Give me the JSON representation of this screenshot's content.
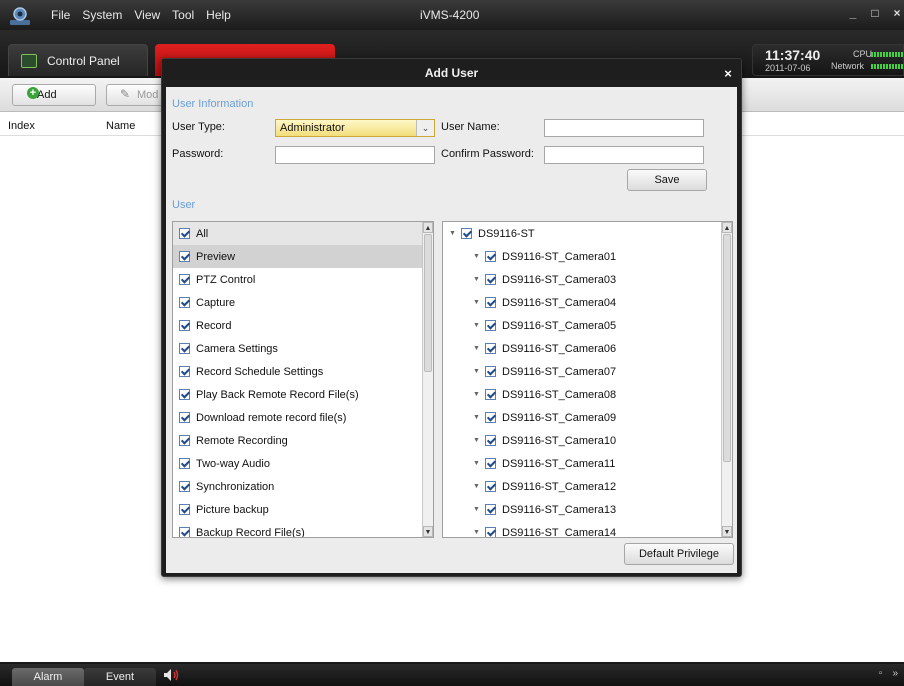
{
  "app": {
    "menu": [
      "File",
      "System",
      "View",
      "Tool",
      "Help"
    ],
    "title": "iVMS-4200",
    "window_buttons": [
      "_",
      "□",
      "×"
    ]
  },
  "tabs": {
    "control_panel": "Control Panel"
  },
  "clock": {
    "time": "11:37:40",
    "date": "2011-07-06",
    "cpu_label": "CPU",
    "network_label": "Network"
  },
  "toolbar": {
    "add_label": "Add",
    "modify_label": "Mod"
  },
  "list_columns": {
    "index": "Index",
    "name": "Name"
  },
  "status_tabs": {
    "alarm": "Alarm",
    "event": "Event"
  },
  "dialog": {
    "title": "Add User",
    "close": "×",
    "section_user_info": "User Information",
    "user_type_label": "User Type:",
    "user_type_value": "Administrator",
    "user_name_label": "User Name:",
    "user_name_value": "",
    "password_label": "Password:",
    "password_value": "",
    "confirm_password_label": "Confirm Password:",
    "confirm_password_value": "",
    "save_label": "Save",
    "section_user": "User",
    "default_privilege_label": "Default Privilege"
  },
  "permissions": {
    "all_label": "All",
    "items": [
      {
        "label": "Preview",
        "checked": true,
        "selected": true
      },
      {
        "label": "PTZ Control",
        "checked": true
      },
      {
        "label": "Capture",
        "checked": true
      },
      {
        "label": "Record",
        "checked": true
      },
      {
        "label": "Camera Settings",
        "checked": true
      },
      {
        "label": "Record Schedule Settings",
        "checked": true
      },
      {
        "label": "Play Back Remote Record File(s)",
        "checked": true
      },
      {
        "label": "Download remote record file(s)",
        "checked": true
      },
      {
        "label": "Remote Recording",
        "checked": true
      },
      {
        "label": "Two-way Audio",
        "checked": true
      },
      {
        "label": "Synchronization",
        "checked": true
      },
      {
        "label": "Picture backup",
        "checked": true
      },
      {
        "label": "Backup Record File(s)",
        "checked": true
      }
    ]
  },
  "devices": {
    "root_label": "DS9116-ST",
    "cameras": [
      "DS9116-ST_Camera01",
      "DS9116-ST_Camera03",
      "DS9116-ST_Camera04",
      "DS9116-ST_Camera05",
      "DS9116-ST_Camera06",
      "DS9116-ST_Camera07",
      "DS9116-ST_Camera08",
      "DS9116-ST_Camera09",
      "DS9116-ST_Camera10",
      "DS9116-ST_Camera11",
      "DS9116-ST_Camera12",
      "DS9116-ST_Camera13",
      "DS9116-ST_Camera14"
    ]
  },
  "icons": {
    "app_logo": "camera-logo-icon",
    "add": "plus-circle-icon",
    "modify": "pencil-icon",
    "speaker": "speaker-icon",
    "expand": "triangle-down-icon"
  },
  "colors": {
    "accent_red_tab": "#d01515",
    "section_title": "#6a9fd6",
    "selected_field": "#f7e8a0",
    "meter_green": "#3fd23f"
  }
}
